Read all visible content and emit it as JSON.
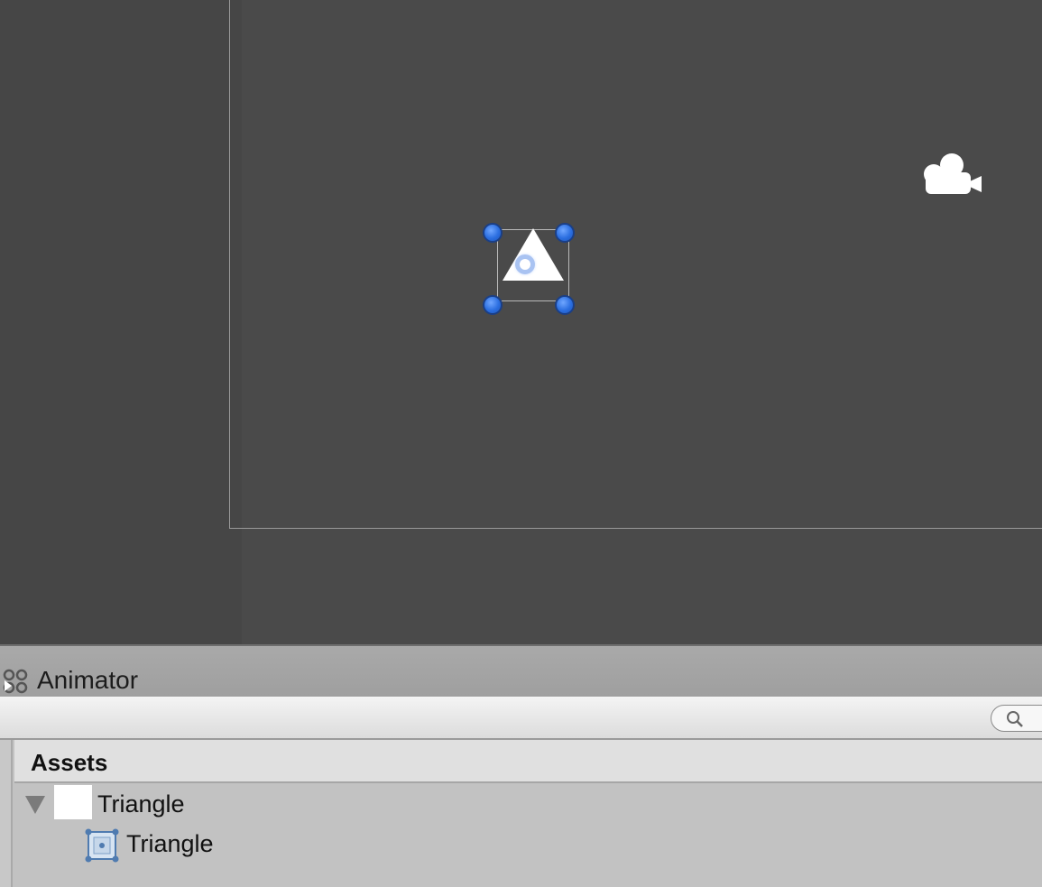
{
  "scene_view": {
    "selected_object": "triangle",
    "handles": [
      "top-left",
      "top-right",
      "bottom-left",
      "bottom-right"
    ],
    "colors": {
      "background": "#4a4a4a",
      "handle": "#2b6ee0",
      "sprite": "#ffffff"
    }
  },
  "animator": {
    "tab_title": "Animator",
    "search_placeholder": ""
  },
  "assets": {
    "header": "Assets",
    "tree": [
      {
        "label": "Triangle",
        "icon": "white-texture-thumbnail",
        "expanded": true
      },
      {
        "label": "Triangle",
        "icon": "sprite-icon"
      }
    ]
  }
}
